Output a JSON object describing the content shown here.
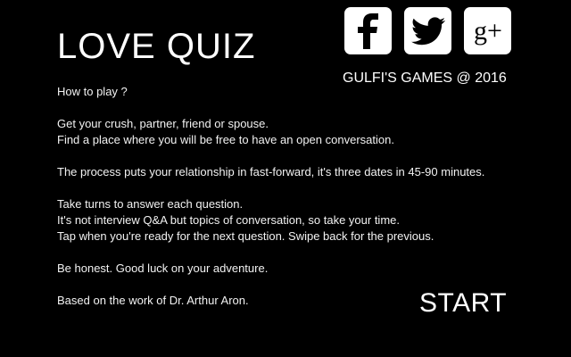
{
  "title": "LOVE QUIZ",
  "credit": "GULFI'S GAMES @ 2016",
  "social": [
    {
      "name": "facebook",
      "icon": "facebook-icon"
    },
    {
      "name": "twitter",
      "icon": "twitter-icon"
    },
    {
      "name": "google-plus",
      "icon": "google-plus-icon",
      "glyph": "g+"
    }
  ],
  "instructions": {
    "heading": "How to play ?",
    "p1_line1": "Get your crush, partner, friend or spouse.",
    "p1_line2": "Find a place where you will be free to have an open conversation.",
    "p2": "The process puts your relationship in fast-forward, it's three dates in 45-90 minutes.",
    "p3_line1": "Take turns to answer each question.",
    "p3_line2": "It's not interview Q&A but topics of conversation, so take your time.",
    "p3_line3": "Tap when you're ready for the next question. Swipe back for the previous.",
    "p4": "Be honest. Good luck on your adventure.",
    "p5": "Based on the work of Dr. Arthur Aron."
  },
  "start_label": "START",
  "colors": {
    "background": "#000000",
    "text": "#ffffff",
    "icon_tile": "#ffffff",
    "icon_glyph": "#000000"
  }
}
